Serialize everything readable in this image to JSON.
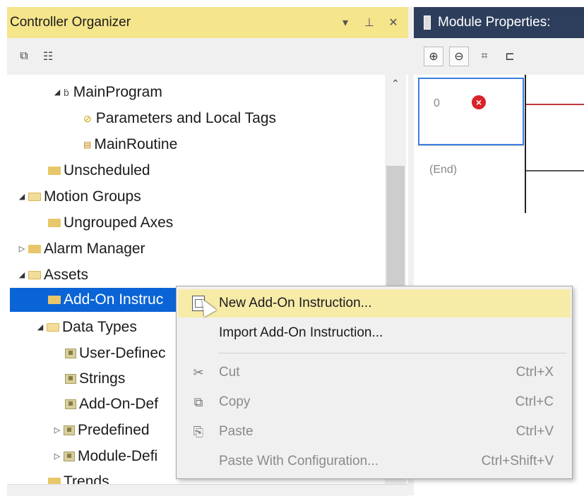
{
  "organizer": {
    "title": "Controller Organizer",
    "title_icons": [
      "chevron-down-icon",
      "pin-icon",
      "close-icon"
    ],
    "toolbar_icons": [
      "collapse-all-icon",
      "show-list-icon"
    ],
    "tree": [
      {
        "label": "MainProgram",
        "icon": "program-icon",
        "expander": "◢",
        "indent": 1
      },
      {
        "label": "Parameters and Local Tags",
        "icon": "tag-icon",
        "expander": "",
        "indent": 2
      },
      {
        "label": "MainRoutine",
        "icon": "routine-icon",
        "expander": "",
        "indent": 2
      },
      {
        "label": "Unscheduled",
        "icon": "folder-icon",
        "expander": "",
        "indent": 1
      },
      {
        "label": "Motion Groups",
        "icon": "folder-open-icon",
        "expander": "◢",
        "indent": 0
      },
      {
        "label": "Ungrouped Axes",
        "icon": "folder-icon",
        "expander": "",
        "indent": 1
      },
      {
        "label": "Alarm Manager",
        "icon": "folder-icon",
        "expander": "▷",
        "indent": 0
      },
      {
        "label": "Assets",
        "icon": "folder-open-icon",
        "expander": "◢",
        "indent": 0
      },
      {
        "label": "Add-On Instruc",
        "icon": "folder-icon",
        "expander": "",
        "indent": 1,
        "selected": true
      },
      {
        "label": "Data Types",
        "icon": "folder-open-icon",
        "expander": "◢",
        "indent": 1
      },
      {
        "label": "User-Definec",
        "icon": "type-icon",
        "expander": "",
        "indent": 2
      },
      {
        "label": "Strings",
        "icon": "type-icon",
        "expander": "",
        "indent": 2
      },
      {
        "label": "Add-On-Def",
        "icon": "type-icon",
        "expander": "",
        "indent": 2
      },
      {
        "label": "Predefined",
        "icon": "type-icon",
        "expander": "▷",
        "indent": 2
      },
      {
        "label": "Module-Defi",
        "icon": "type-icon",
        "expander": "▷",
        "indent": 2
      },
      {
        "label": "Trends",
        "icon": "folder-icon",
        "expander": "",
        "indent": 1
      }
    ]
  },
  "module_props": {
    "title": "Module Properties:",
    "toolbar_icons": [
      "zoom-in-icon",
      "zoom-out-icon",
      "grid-icon",
      "branch-icon"
    ],
    "rung_number": "0",
    "end_label": "(End)"
  },
  "context_menu": {
    "items": [
      {
        "label": "New Add-On Instruction...",
        "shortcut": "",
        "icon": "new-aoi-icon",
        "enabled": true,
        "highlighted": true
      },
      {
        "label": "Import Add-On Instruction...",
        "shortcut": "",
        "icon": "",
        "enabled": true
      },
      {
        "label": "Cut",
        "shortcut": "Ctrl+X",
        "icon": "cut-icon",
        "enabled": false
      },
      {
        "label": "Copy",
        "shortcut": "Ctrl+C",
        "icon": "copy-icon",
        "enabled": false
      },
      {
        "label": "Paste",
        "shortcut": "Ctrl+V",
        "icon": "paste-icon",
        "enabled": false
      },
      {
        "label": "Paste With Configuration...",
        "shortcut": "Ctrl+Shift+V",
        "icon": "",
        "enabled": false
      }
    ]
  },
  "colors": {
    "titlebar": "#f5e58b",
    "selection": "#0a64d6",
    "menu_highlight": "#f7eba8",
    "right_titlebar": "#2d3e5c"
  }
}
